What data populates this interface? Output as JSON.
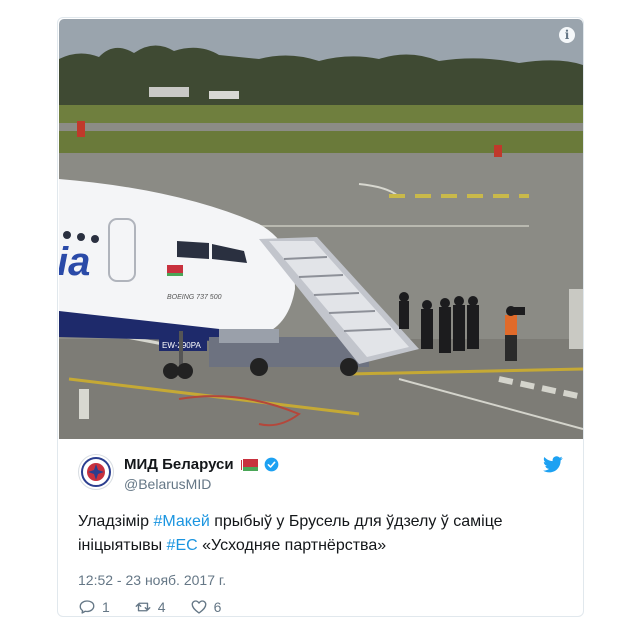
{
  "tweet": {
    "author_name": "МИД Беларуси",
    "author_handle": "@BelarusMID",
    "text_parts": [
      "Уладзімір ",
      "#Макей",
      " прыбыў у Брусель для ўдзелу ў саміце ініцыятывы ",
      "#ЕС",
      " «Усходняе партнёрства»"
    ],
    "timestamp": "12:52 - 23 нояб. 2017 г.",
    "replies": "1",
    "retweets": "4",
    "likes": "6"
  },
  "photo": {
    "description_icon": "info-icon",
    "aircraft_lettering": "ia",
    "aircraft_model": "BOEING 737 500",
    "registration": "EW-290PA"
  },
  "icons": [
    "info-icon",
    "avatar-emblem-icon",
    "belarus-flag-icon",
    "verified-badge-icon",
    "twitter-bird-icon",
    "reply-icon",
    "retweet-icon",
    "like-icon"
  ],
  "colors": {
    "link": "#1b95e0",
    "verified": "#1da1f2",
    "text": "#14171a",
    "muted": "#657786",
    "border": "#e1e8ed"
  }
}
